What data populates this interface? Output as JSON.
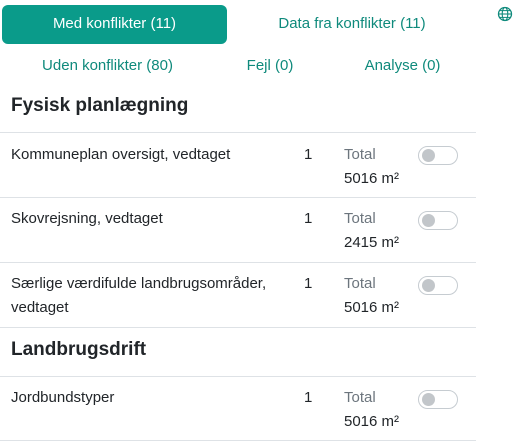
{
  "tabs": {
    "active": "Med konflikter (11)",
    "data_from_conflicts": "Data fra konflikter (11)",
    "without_conflicts": "Uden konflikter (80)",
    "errors": "Fejl (0)",
    "analysis": "Analyse (0)"
  },
  "icons": {
    "language": "globe-icon"
  },
  "colors": {
    "accent": "#0a9b8a",
    "link": "#0f8a7c",
    "muted": "#6c757d"
  },
  "sections": [
    {
      "title": "Fysisk planlægning",
      "rows": [
        {
          "name": "Kommuneplan oversigt, vedtaget",
          "count": "1",
          "total_label": "Total",
          "total_value": "5016 m²",
          "toggle_on": false
        },
        {
          "name": "Skovrejsning, vedtaget",
          "count": "1",
          "total_label": "Total",
          "total_value": "2415 m²",
          "toggle_on": false
        },
        {
          "name": "Særlige værdifulde landbrugsområder, vedtaget",
          "count": "1",
          "total_label": "Total",
          "total_value": "5016 m²",
          "toggle_on": false
        }
      ]
    },
    {
      "title": "Landbrugsdrift",
      "rows": [
        {
          "name": "Jordbundstyper",
          "count": "1",
          "total_label": "Total",
          "total_value": "5016 m²",
          "toggle_on": false
        }
      ]
    }
  ]
}
